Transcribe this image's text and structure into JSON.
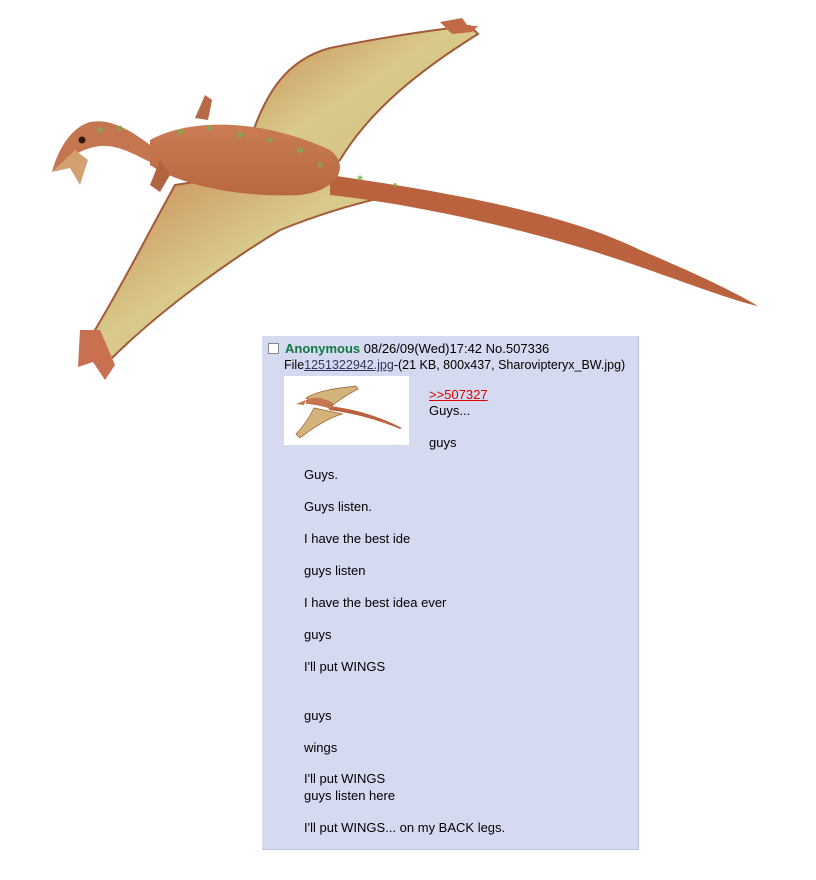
{
  "post": {
    "name": "Anonymous",
    "datetime": "08/26/09(Wed)17:42",
    "number_label": "No.507336",
    "file_prefix": "File",
    "file_link": "1251322942.jpg",
    "file_info": "-(21 KB, 800x437, Sharovipteryx_BW.jpg)",
    "quote_link": ">>507327",
    "lines": [
      "Guys...",
      "guys",
      "Guys.",
      "Guys listen.",
      "I have the best ide",
      "guys listen",
      "I have the best idea ever",
      "guys",
      "I'll put WINGS",
      "guys",
      "wings",
      "I'll put WINGS",
      "guys listen here",
      "I'll put WINGS... on my BACK legs."
    ]
  },
  "colors": {
    "post_bg": "#d6daf0",
    "name": "#117743",
    "quote": "#dd0000",
    "file_link": "#34345c"
  },
  "icons": {
    "hero": "pterosaur-illustration",
    "thumb": "pterosaur-thumbnail",
    "checkbox": "delete-checkbox"
  }
}
